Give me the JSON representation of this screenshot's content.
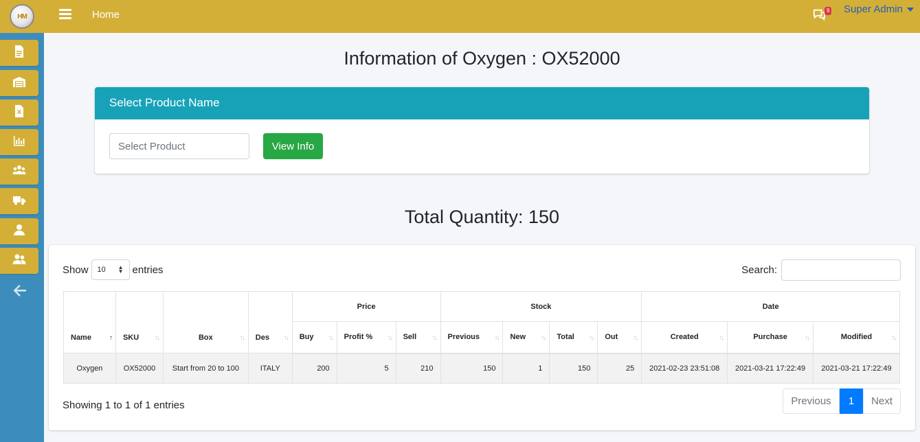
{
  "topbar": {
    "home_label": "Home",
    "messages_badge": "9",
    "user_name": "Super Admin"
  },
  "sidebar": {
    "items": [
      {
        "icon": "document-icon"
      },
      {
        "icon": "warehouse-icon"
      },
      {
        "icon": "excel-file-icon"
      },
      {
        "icon": "bar-chart-icon"
      },
      {
        "icon": "users-group-icon"
      },
      {
        "icon": "truck-icon"
      },
      {
        "icon": "user-icon"
      },
      {
        "icon": "user-friends-icon"
      }
    ],
    "back_icon": "arrow-left-icon"
  },
  "main": {
    "title": "Information of Oxygen : OX52000",
    "card_header": "Select Product Name",
    "select_placeholder": "Select Product",
    "view_button": "View Info",
    "total_quantity": "Total Quantity: 150"
  },
  "table_controls": {
    "show_label": "Show",
    "page_length": "10",
    "entries_label": "entries",
    "search_label": "Search:"
  },
  "table": {
    "group_headers": [
      "Price",
      "Stock",
      "Date"
    ],
    "columns": [
      "Name",
      "SKU",
      "Box",
      "Des",
      "Buy",
      "Profit %",
      "Sell",
      "Previous",
      "New",
      "Total",
      "Out",
      "Created",
      "Purchase",
      "Modified"
    ],
    "rows": [
      [
        "Oxygen",
        "OX52000",
        "Start from 20 to 100",
        "ITALY",
        "200",
        "5",
        "210",
        "150",
        "1",
        "150",
        "25",
        "2021-02-23 23:51:08",
        "2021-03-21 17:22:49",
        "2021-03-21 17:22:49"
      ]
    ]
  },
  "footer": {
    "showing_text": "Showing 1 to 1 of 1 entries",
    "previous_label": "Previous",
    "current_page": "1",
    "next_label": "Next"
  },
  "colors": {
    "topbar": "#d4af37",
    "sidebar": "#3c8dbc",
    "card_header": "#17a2b8",
    "view_button": "#28a745",
    "active_page": "#007bff"
  }
}
